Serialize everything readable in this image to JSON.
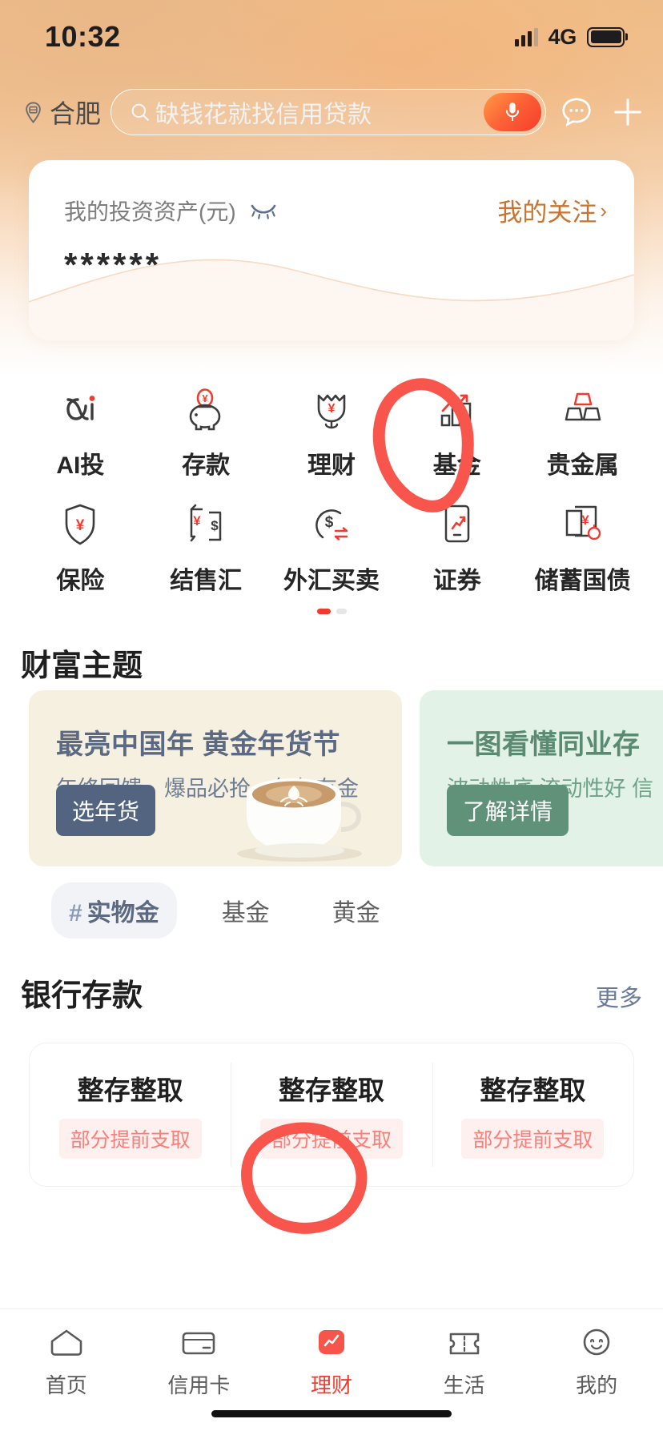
{
  "status_bar": {
    "time": "10:32",
    "network": "4G",
    "signal_icon": "signal-bars-icon",
    "battery_icon": "battery-full-icon"
  },
  "header": {
    "city": "合肥",
    "city_icon": "location-pin-icon",
    "search_placeholder": "缺钱花就找信用贷款",
    "search_icon": "search-icon",
    "mic_icon": "microphone-icon",
    "message_icon": "chat-bubble-icon",
    "add_icon": "plus-icon"
  },
  "asset_card": {
    "label": "我的投资资产(元)",
    "eye_icon": "eye-closed-icon",
    "masked_value": "******",
    "focus_link": "我的关注",
    "chevron": "›"
  },
  "grid": {
    "items": [
      {
        "label": "AI投",
        "icon": "alpha-ai-icon"
      },
      {
        "label": "存款",
        "icon": "piggy-bank-icon"
      },
      {
        "label": "理财",
        "icon": "tulip-yuan-icon"
      },
      {
        "label": "基金",
        "icon": "bar-chart-trend-icon"
      },
      {
        "label": "贵金属",
        "icon": "gold-bars-icon"
      },
      {
        "label": "保险",
        "icon": "shield-yuan-icon"
      },
      {
        "label": "结售汇",
        "icon": "currency-exchange-icon"
      },
      {
        "label": "外汇买卖",
        "icon": "dollar-swap-icon"
      },
      {
        "label": "证券",
        "icon": "phone-trend-icon"
      },
      {
        "label": "储蓄国债",
        "icon": "bond-documents-icon"
      }
    ],
    "pagination": {
      "total": 2,
      "active": 1
    }
  },
  "wealth_section": {
    "title": "财富主题",
    "cards": [
      {
        "title": "最亮中国年 黄金年货节",
        "subtitle": "年终回馈、爆品必抢、年年有金",
        "button": "选年货",
        "image": "latte-coffee-cup-image"
      },
      {
        "title": "一图看懂同业存",
        "subtitle": "波动性底 流动性好 信",
        "button": "了解详情"
      }
    ],
    "tags": [
      {
        "label": "实物金",
        "hash": "#",
        "active": true
      },
      {
        "label": "基金",
        "hash": "",
        "active": false
      },
      {
        "label": "黄金",
        "hash": "",
        "active": false
      }
    ]
  },
  "deposit_section": {
    "title": "银行存款",
    "more": "更多",
    "products": [
      {
        "name": "整存整取",
        "badge": "部分提前支取"
      },
      {
        "name": "整存整取",
        "badge": "部分提前支取"
      },
      {
        "name": "整存整取",
        "badge": "部分提前支取"
      }
    ]
  },
  "tabbar": {
    "items": [
      {
        "label": "首页",
        "icon": "home-icon",
        "active": false
      },
      {
        "label": "信用卡",
        "icon": "credit-card-icon",
        "active": false
      },
      {
        "label": "理财",
        "icon": "finance-icon",
        "active": true
      },
      {
        "label": "生活",
        "icon": "ticket-icon",
        "active": false
      },
      {
        "label": "我的",
        "icon": "user-smile-icon",
        "active": false
      }
    ]
  },
  "annotations": {
    "circle_fund": "red-circle-around-fund-icon",
    "circle_tab": "red-circle-around-finance-tab"
  },
  "colors": {
    "accent_red": "#f23b2f",
    "header_orange": "#edbc89",
    "link_brown": "#c8742e"
  }
}
